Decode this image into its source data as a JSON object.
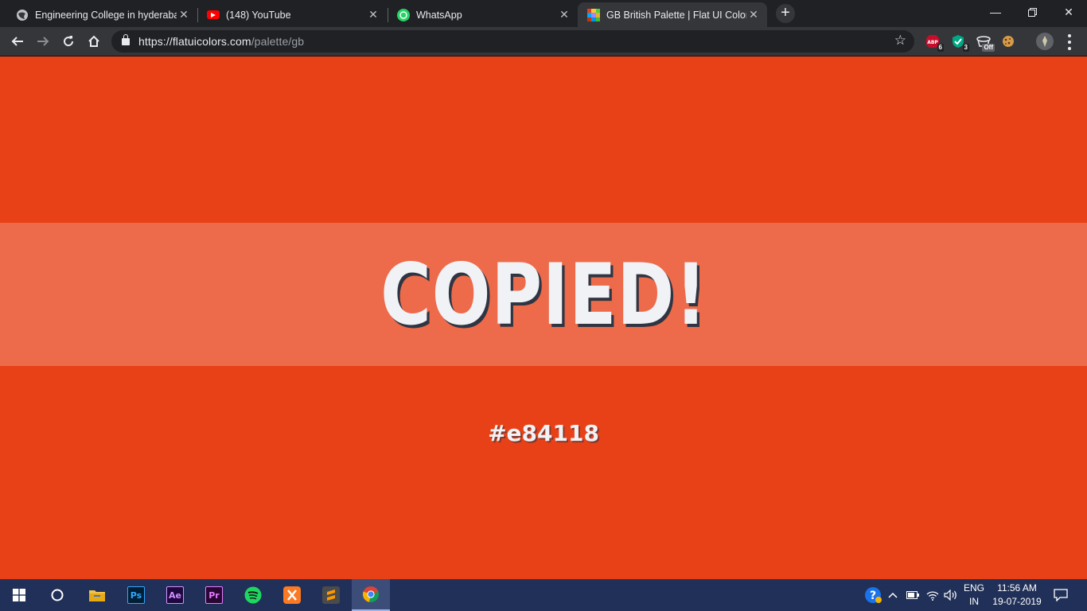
{
  "browser": {
    "tabs": [
      {
        "title": "Engineering College in hyderabad",
        "favicon": "globe-icon",
        "active": false
      },
      {
        "title": "(148) YouTube",
        "favicon": "youtube-icon",
        "active": false
      },
      {
        "title": "WhatsApp",
        "favicon": "whatsapp-icon",
        "active": false
      },
      {
        "title": "GB British Palette | Flat UI Colors",
        "favicon": "flatuicolors-icon",
        "active": true
      }
    ],
    "url_host": "https://flatuicolors.com",
    "url_path": "/palette/gb",
    "extensions": [
      {
        "name": "abp-icon",
        "label": "ABP",
        "badge": "6"
      },
      {
        "name": "shield-check-icon",
        "label": "✓",
        "badge": "3"
      },
      {
        "name": "cup-off-icon",
        "label": "☕",
        "badge": "Off"
      },
      {
        "name": "cookie-icon",
        "label": "🍪",
        "badge": ""
      },
      {
        "name": "profile-avatar-icon",
        "label": "",
        "badge": ""
      }
    ]
  },
  "page": {
    "copied_message": "COPIED!",
    "color_hex": "#e84118",
    "background_color": "#e84118"
  },
  "taskbar": {
    "apps": [
      {
        "name": "windows-start-icon"
      },
      {
        "name": "cortana-search-icon"
      },
      {
        "name": "file-explorer-icon"
      },
      {
        "name": "photoshop-icon",
        "label": "Ps"
      },
      {
        "name": "after-effects-icon",
        "label": "Ae"
      },
      {
        "name": "premiere-pro-icon",
        "label": "Pr"
      },
      {
        "name": "spotify-icon"
      },
      {
        "name": "xampp-icon"
      },
      {
        "name": "sublime-text-icon"
      },
      {
        "name": "chrome-icon"
      }
    ],
    "language": "ENG",
    "region": "IN",
    "time": "11:56 AM",
    "date": "19-07-2019"
  }
}
